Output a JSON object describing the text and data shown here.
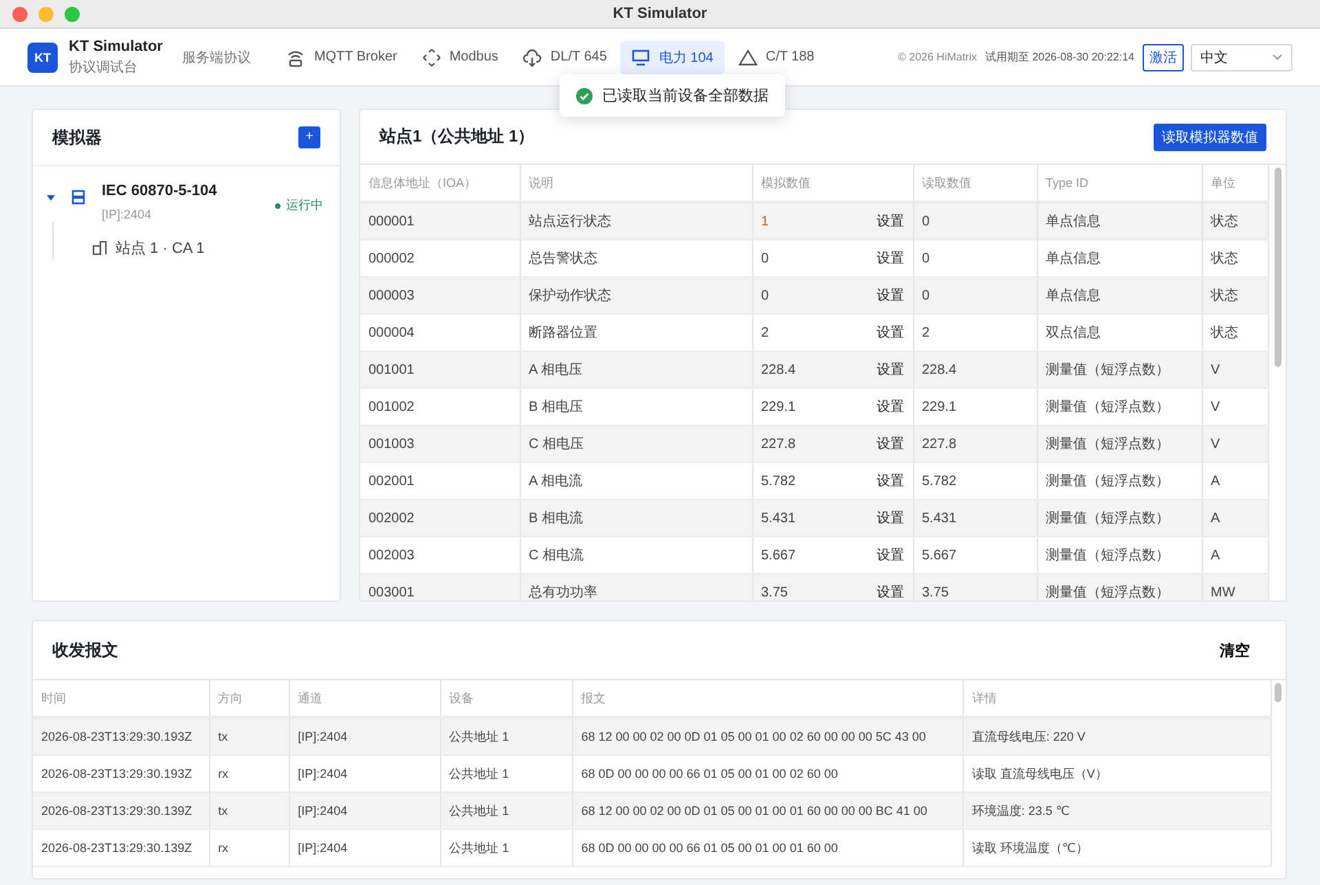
{
  "window": {
    "title": "KT Simulator"
  },
  "header": {
    "logo": "KT",
    "app_name": "KT Simulator",
    "app_subtitle": "协议调试台",
    "group_label": "服务端协议",
    "nav": [
      {
        "label": "MQTT Broker",
        "kind": "router",
        "selected": false
      },
      {
        "label": "Modbus",
        "kind": "move",
        "selected": false
      },
      {
        "label": "DL/T 645",
        "kind": "cloud",
        "selected": false
      },
      {
        "label": "电力 104",
        "kind": "monitor",
        "selected": true
      },
      {
        "label": "C/T 188",
        "kind": "triangle",
        "selected": false
      }
    ],
    "copyright": "© 2026 HiMatrix",
    "trial": "试用期至 2026-08-30 20:22:14",
    "activate_button": "激活",
    "language": "中文"
  },
  "toast": {
    "message": "已读取当前设备全部数据"
  },
  "simulator_panel": {
    "title": "模拟器",
    "add_button": "+",
    "tree": [
      {
        "name": "IEC 60870-5-104",
        "address": "[IP]:2404",
        "status": "运行中",
        "running": true,
        "expanded": true,
        "children": [
          {
            "name": "站点 1 · CA 1"
          }
        ]
      }
    ]
  },
  "station_panel": {
    "title": "站点1（公共地址 1）",
    "read_button": "读取模拟器数值",
    "columns": [
      "信息体地址（IOA）",
      "说明",
      "模拟数值",
      "读取数值",
      "Type ID",
      "单位"
    ],
    "rows": [
      {
        "ioa": "000001",
        "description": "站点运行状态",
        "sim_value": "1",
        "modified": true,
        "set_label": "设置",
        "read_value": "0",
        "type_id": "单点信息",
        "unit": "状态"
      },
      {
        "ioa": "000002",
        "description": "总告警状态",
        "sim_value": "0",
        "modified": false,
        "set_label": "设置",
        "read_value": "0",
        "type_id": "单点信息",
        "unit": "状态"
      },
      {
        "ioa": "000003",
        "description": "保护动作状态",
        "sim_value": "0",
        "modified": false,
        "set_label": "设置",
        "read_value": "0",
        "type_id": "单点信息",
        "unit": "状态"
      },
      {
        "ioa": "000004",
        "description": "断路器位置",
        "sim_value": "2",
        "modified": false,
        "set_label": "设置",
        "read_value": "2",
        "type_id": "双点信息",
        "unit": "状态"
      },
      {
        "ioa": "001001",
        "description": "A 相电压",
        "sim_value": "228.4",
        "modified": false,
        "set_label": "设置",
        "read_value": "228.4",
        "type_id": "测量值（短浮点数）",
        "unit": "V"
      },
      {
        "ioa": "001002",
        "description": "B 相电压",
        "sim_value": "229.1",
        "modified": false,
        "set_label": "设置",
        "read_value": "229.1",
        "type_id": "测量值（短浮点数）",
        "unit": "V"
      },
      {
        "ioa": "001003",
        "description": "C 相电压",
        "sim_value": "227.8",
        "modified": false,
        "set_label": "设置",
        "read_value": "227.8",
        "type_id": "测量值（短浮点数）",
        "unit": "V"
      },
      {
        "ioa": "002001",
        "description": "A 相电流",
        "sim_value": "5.782",
        "modified": false,
        "set_label": "设置",
        "read_value": "5.782",
        "type_id": "测量值（短浮点数）",
        "unit": "A"
      },
      {
        "ioa": "002002",
        "description": "B 相电流",
        "sim_value": "5.431",
        "modified": false,
        "set_label": "设置",
        "read_value": "5.431",
        "type_id": "测量值（短浮点数）",
        "unit": "A"
      },
      {
        "ioa": "002003",
        "description": "C 相电流",
        "sim_value": "5.667",
        "modified": false,
        "set_label": "设置",
        "read_value": "5.667",
        "type_id": "测量值（短浮点数）",
        "unit": "A"
      },
      {
        "ioa": "003001",
        "description": "总有功功率",
        "sim_value": "3.75",
        "modified": false,
        "set_label": "设置",
        "read_value": "3.75",
        "type_id": "测量值（短浮点数）",
        "unit": "MW"
      }
    ]
  },
  "log_panel": {
    "title": "收发报文",
    "clear_button": "清空",
    "columns": [
      "时间",
      "方向",
      "通道",
      "设备",
      "报文",
      "详情"
    ],
    "rows": [
      {
        "time": "2026-08-23T13:29:30.193Z",
        "direction": "tx",
        "channel": "[IP]:2404",
        "device": "公共地址 1",
        "frame": "68 12 00 00 02 00 0D 01 05 00 01 00 02 60 00 00 00 5C 43 00",
        "detail": "直流母线电压: 220 V"
      },
      {
        "time": "2026-08-23T13:29:30.193Z",
        "direction": "rx",
        "channel": "[IP]:2404",
        "device": "公共地址 1",
        "frame": "68 0D 00 00 00 00 66 01 05 00 01 00 02 60 00",
        "detail": "读取 直流母线电压（V）"
      },
      {
        "time": "2026-08-23T13:29:30.139Z",
        "direction": "tx",
        "channel": "[IP]:2404",
        "device": "公共地址 1",
        "frame": "68 12 00 00 02 00 0D 01 05 00 01 00 01 60 00 00 00 BC 41 00",
        "detail": "环境温度: 23.5 ℃"
      },
      {
        "time": "2026-08-23T13:29:30.139Z",
        "direction": "rx",
        "channel": "[IP]:2404",
        "device": "公共地址 1",
        "frame": "68 0D 00 00 00 00 66 01 05 00 01 00 01 60 00",
        "detail": "读取 环境温度（℃）"
      }
    ]
  }
}
